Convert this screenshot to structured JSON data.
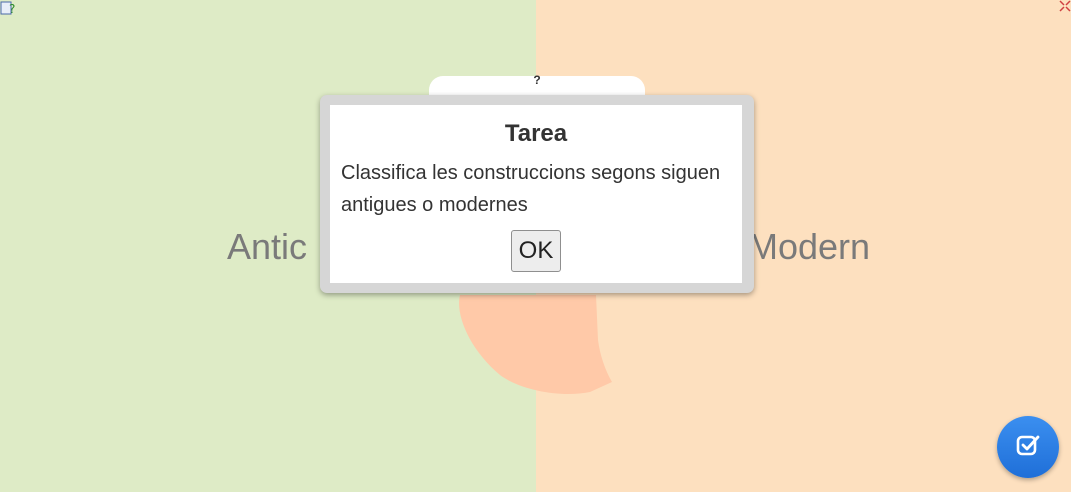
{
  "zones": {
    "left_label": "Antic",
    "right_label": "Modern"
  },
  "help": {
    "label": "?"
  },
  "dialog": {
    "title": "Tarea",
    "message": "Classifica les construccions segons siguen antigues o modernes",
    "ok_label": "OK"
  },
  "colors": {
    "left_zone": "#deebc6",
    "right_zone": "#fde0bf",
    "accent_button": "#2b7fe6"
  },
  "icons": {
    "check": "checkbox-check-icon",
    "help": "help-icon",
    "fullscreen": "fullscreen-icon"
  }
}
